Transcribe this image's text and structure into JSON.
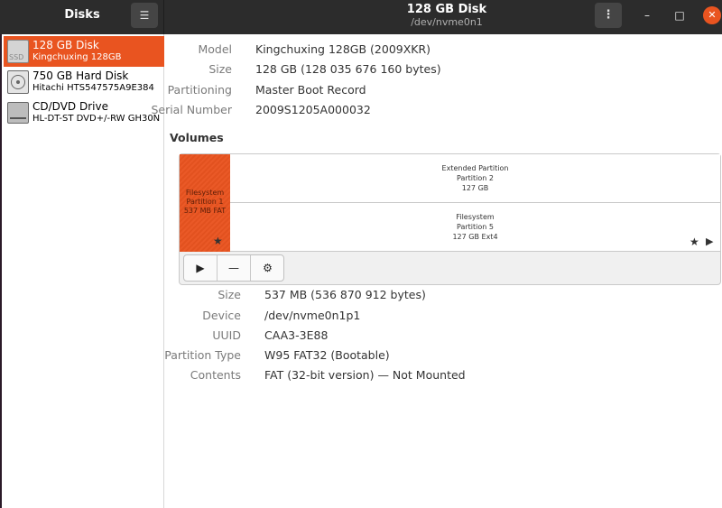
{
  "app": {
    "sidebar_title": "Disks",
    "title": "128 GB Disk",
    "subtitle": "/dev/nvme0n1",
    "menu_icon": "hamburger-menu-icon",
    "accent": "#e95420"
  },
  "sidebar": {
    "items": [
      {
        "name": "128 GB Disk",
        "model": "Kingchuxing 128GB",
        "icon": "ssd-icon",
        "icon_text": "SSD",
        "selected": true
      },
      {
        "name": "750 GB Hard Disk",
        "model": "Hitachi HTS547575A9E384",
        "icon": "hard-disk-icon",
        "selected": false
      },
      {
        "name": "CD/DVD Drive",
        "model": "HL-DT-ST DVD+/-RW GH30N",
        "icon": "optical-drive-icon",
        "selected": false
      }
    ]
  },
  "disk_info": {
    "model_label": "Model",
    "model": "Kingchuxing 128GB (2009XKR)",
    "size_label": "Size",
    "size": "128 GB (128 035 676 160 bytes)",
    "partitioning_label": "Partitioning",
    "partitioning": "Master Boot Record",
    "serial_label": "Serial Number",
    "serial": "2009S1205A000032"
  },
  "volumes": {
    "title": "Volumes",
    "partition1": {
      "line1": "Filesystem",
      "line2": "Partition 1",
      "line3": "537 MB FAT"
    },
    "extended": {
      "line1": "Extended Partition",
      "line2": "Partition 2",
      "line3": "127 GB"
    },
    "partition5": {
      "line1": "Filesystem",
      "line2": "Partition 5",
      "line3": "127 GB Ext4"
    },
    "toolbar": {
      "mount_icon": "play-icon",
      "delete_icon": "minus-icon",
      "settings_icon": "gears-icon"
    }
  },
  "partition_info": {
    "size_label": "Size",
    "size": "537 MB (536 870 912 bytes)",
    "device_label": "Device",
    "device": "/dev/nvme0n1p1",
    "uuid_label": "UUID",
    "uuid": "CAA3-3E88",
    "type_label": "Partition Type",
    "type": "W95 FAT32 (Bootable)",
    "contents_label": "Contents",
    "contents": "FAT (32-bit version) — Not Mounted"
  },
  "window_controls": {
    "minimize": "minimize-icon",
    "maximize": "maximize-icon",
    "close": "close-icon"
  }
}
